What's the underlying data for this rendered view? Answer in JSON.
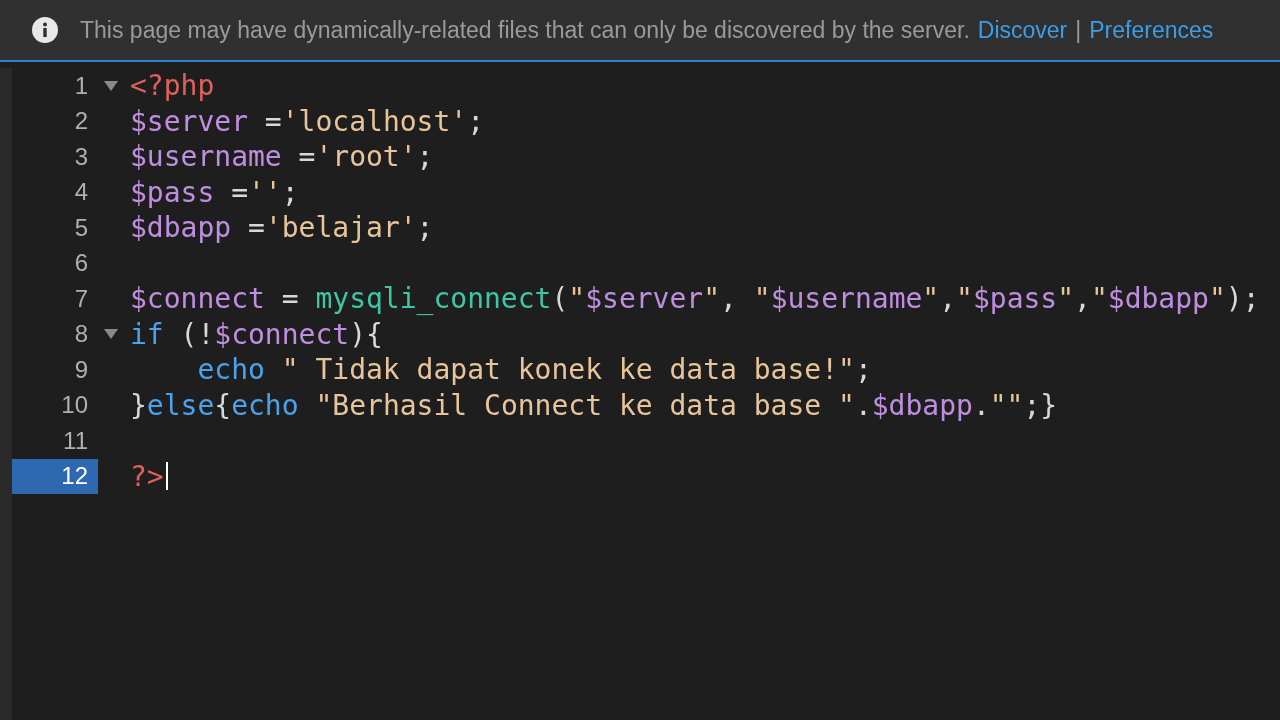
{
  "info_bar": {
    "message": "This page may have dynamically-related files that can only be discovered by the server.",
    "links": [
      "Discover",
      "Preferences"
    ],
    "separator": "|"
  },
  "editor": {
    "lines": [
      {
        "number": "1",
        "foldable": true,
        "selected": false,
        "tokens": [
          {
            "text": "<?php",
            "kind": "tag"
          }
        ]
      },
      {
        "number": "2",
        "foldable": false,
        "selected": false,
        "tokens": [
          {
            "text": "$server",
            "kind": "var"
          },
          {
            "text": " =",
            "kind": "plain"
          },
          {
            "text": "'localhost'",
            "kind": "str"
          },
          {
            "text": ";",
            "kind": "plain"
          }
        ]
      },
      {
        "number": "3",
        "foldable": false,
        "selected": false,
        "tokens": [
          {
            "text": "$username",
            "kind": "var"
          },
          {
            "text": " =",
            "kind": "plain"
          },
          {
            "text": "'root'",
            "kind": "str"
          },
          {
            "text": ";",
            "kind": "plain"
          }
        ]
      },
      {
        "number": "4",
        "foldable": false,
        "selected": false,
        "tokens": [
          {
            "text": "$pass",
            "kind": "var"
          },
          {
            "text": " =",
            "kind": "plain"
          },
          {
            "text": "''",
            "kind": "str"
          },
          {
            "text": ";",
            "kind": "plain"
          }
        ]
      },
      {
        "number": "5",
        "foldable": false,
        "selected": false,
        "tokens": [
          {
            "text": "$dbapp",
            "kind": "var"
          },
          {
            "text": " =",
            "kind": "plain"
          },
          {
            "text": "'belajar'",
            "kind": "str"
          },
          {
            "text": ";",
            "kind": "plain"
          }
        ]
      },
      {
        "number": "6",
        "foldable": false,
        "selected": false
      },
      {
        "number": "7",
        "foldable": false,
        "selected": false,
        "tokens": [
          {
            "text": "$connect",
            "kind": "var"
          },
          {
            "text": " = ",
            "kind": "plain"
          },
          {
            "text": "mysqli_connect",
            "kind": "func"
          },
          {
            "text": "(",
            "kind": "plain"
          },
          {
            "text": "\"",
            "kind": "str"
          },
          {
            "text": "$server",
            "kind": "var"
          },
          {
            "text": "\"",
            "kind": "str"
          },
          {
            "text": ", ",
            "kind": "plain"
          },
          {
            "text": "\"",
            "kind": "str"
          },
          {
            "text": "$username",
            "kind": "var"
          },
          {
            "text": "\"",
            "kind": "str"
          },
          {
            "text": ",",
            "kind": "plain"
          },
          {
            "text": "\"",
            "kind": "str"
          },
          {
            "text": "$pass",
            "kind": "var"
          },
          {
            "text": "\"",
            "kind": "str"
          },
          {
            "text": ",",
            "kind": "plain"
          },
          {
            "text": "\"",
            "kind": "str"
          },
          {
            "text": "$dbapp",
            "kind": "var"
          },
          {
            "text": "\"",
            "kind": "str"
          },
          {
            "text": ");",
            "kind": "plain"
          }
        ]
      },
      {
        "number": "8",
        "foldable": true,
        "selected": false,
        "tokens": [
          {
            "text": "if",
            "kind": "kw"
          },
          {
            "text": " (!",
            "kind": "plain"
          },
          {
            "text": "$connect",
            "kind": "var"
          },
          {
            "text": "){",
            "kind": "plain"
          }
        ]
      },
      {
        "number": "9",
        "foldable": false,
        "selected": false,
        "tokens": [
          {
            "text": "    echo",
            "kind": "kw"
          },
          {
            "text": " \" Tidak dapat konek ke data base!\"",
            "kind": "str"
          },
          {
            "text": ";",
            "kind": "plain"
          }
        ]
      },
      {
        "number": "10",
        "foldable": false,
        "selected": false,
        "tokens": [
          {
            "text": "}",
            "kind": "plain"
          },
          {
            "text": "else",
            "kind": "kw"
          },
          {
            "text": "{",
            "kind": "plain"
          },
          {
            "text": "echo",
            "kind": "kw"
          },
          {
            "text": " \"Berhasil Connect ke data base \"",
            "kind": "str"
          },
          {
            "text": ".",
            "kind": "plain"
          },
          {
            "text": "$dbapp",
            "kind": "var"
          },
          {
            "text": ".",
            "kind": "plain"
          },
          {
            "text": "\"\"",
            "kind": "str"
          },
          {
            "text": ";}",
            "kind": "plain"
          }
        ]
      },
      {
        "number": "11",
        "foldable": false,
        "selected": false
      },
      {
        "number": "12",
        "foldable": false,
        "selected": true,
        "tokens": [
          {
            "text": "?>",
            "kind": "tag"
          }
        ]
      }
    ]
  }
}
